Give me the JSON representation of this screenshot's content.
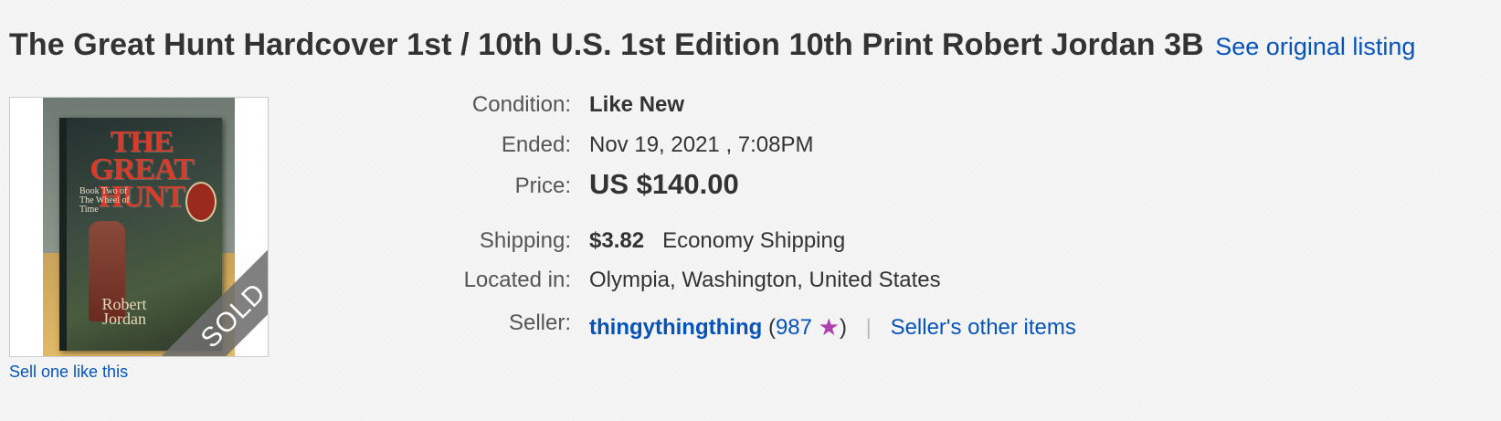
{
  "listing": {
    "title": "The Great Hunt Hardcover 1st / 10th U.S. 1st Edition 10th Print Robert Jordan 3B",
    "see_original": "See original listing",
    "sold_label": "SOLD",
    "sell_one": "Sell one like this",
    "image_alt": "The Great Hunt book cover"
  },
  "cover": {
    "title_line1": "THE GREAT",
    "title_line2": "HUNT",
    "subtitle": "Book Two of The Wheel of Time",
    "author_line1": "Robert",
    "author_line2": "Jordan"
  },
  "details": {
    "condition_label": "Condition:",
    "condition_value": "Like New",
    "ended_label": "Ended:",
    "ended_value": "Nov 19, 2021 , 7:08PM",
    "price_label": "Price:",
    "price_value": "US $140.00",
    "shipping_label": "Shipping:",
    "shipping_cost": "$3.82",
    "shipping_method": "Economy Shipping",
    "location_label": "Located in:",
    "location_value": "Olympia, Washington, United States",
    "seller_label": "Seller:",
    "seller_name": "thingythingthing",
    "feedback_open": "(",
    "feedback_score": "987",
    "feedback_close": ")",
    "separator": "|",
    "other_items": "Seller's other items"
  },
  "colors": {
    "link": "#0654ba",
    "star": "#b040b0",
    "background": "#f5f5f5"
  },
  "icons": {
    "feedback_star": "star-icon"
  }
}
